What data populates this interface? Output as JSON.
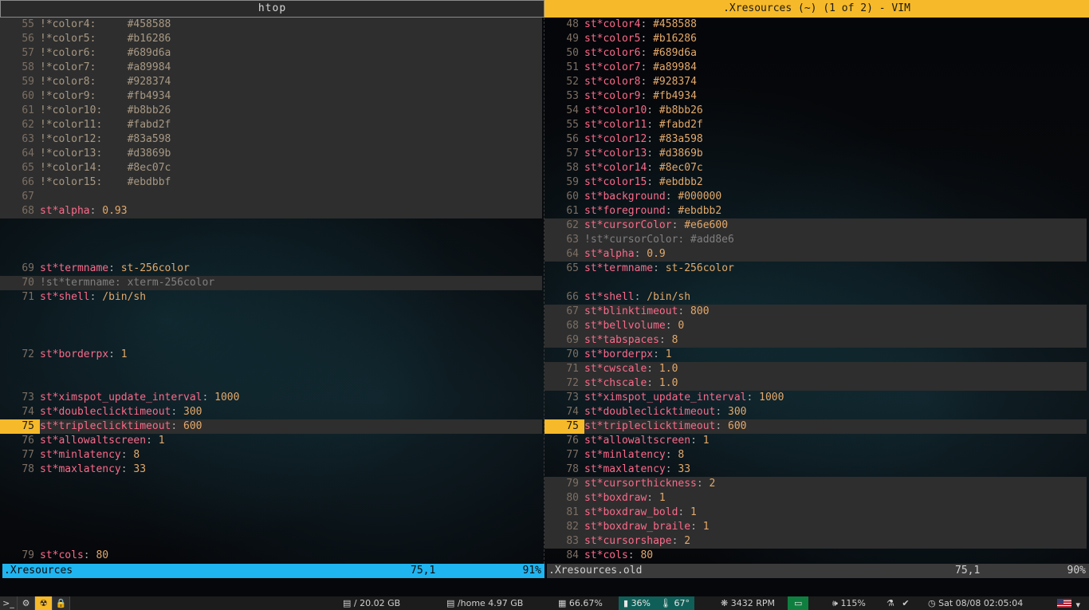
{
  "window": {
    "left_title": "htop",
    "right_title": ".Xresources (~) (1 of 2) - VIM"
  },
  "left_pane": {
    "lines": [
      {
        "n": "55",
        "text": "!*color4:     #458588"
      },
      {
        "n": "56",
        "text": "!*color5:     #b16286"
      },
      {
        "n": "57",
        "text": "!*color6:     #689d6a"
      },
      {
        "n": "58",
        "text": "!*color7:     #a89984"
      },
      {
        "n": "59",
        "text": "!*color8:     #928374"
      },
      {
        "n": "60",
        "text": "!*color9:     #fb4934"
      },
      {
        "n": "61",
        "text": "!*color10:    #b8bb26"
      },
      {
        "n": "62",
        "text": "!*color11:    #fabd2f"
      },
      {
        "n": "63",
        "text": "!*color12:    #83a598"
      },
      {
        "n": "64",
        "text": "!*color13:    #d3869b"
      },
      {
        "n": "65",
        "text": "!*color14:    #8ec07c"
      },
      {
        "n": "66",
        "text": "!*color15:    #ebdbbf"
      },
      {
        "n": "67",
        "text": ""
      },
      {
        "n": "68",
        "key": "st*alpha",
        "val": " 0.93"
      },
      {
        "n": "69",
        "key": "st*termname",
        "val": " st-256color"
      },
      {
        "n": "70",
        "text": "!st*termname: xterm-256color"
      },
      {
        "n": "71",
        "key": "st*shell",
        "val": " /bin/sh"
      },
      {
        "n": "72",
        "key": "st*borderpx",
        "val": " 1"
      },
      {
        "n": "73",
        "key": "st*ximspot_update_interval",
        "val": " 1000"
      },
      {
        "n": "74",
        "key": "st*doubleclicktimeout",
        "val": " 300"
      },
      {
        "n": "75",
        "key": "st*tripleclicktimeout",
        "val": " 600"
      },
      {
        "n": "76",
        "key": "st*allowaltscreen",
        "val": " 1"
      },
      {
        "n": "77",
        "key": "st*minlatency",
        "val": " 8"
      },
      {
        "n": "78",
        "key": "st*maxlatency",
        "val": " 33"
      },
      {
        "n": "79",
        "key": "st*cols",
        "val": " 80"
      }
    ]
  },
  "right_pane": {
    "lines": [
      {
        "n": "48",
        "key": "st*color4",
        "val": " #458588"
      },
      {
        "n": "49",
        "key": "st*color5",
        "val": " #b16286"
      },
      {
        "n": "50",
        "key": "st*color6",
        "val": " #689d6a"
      },
      {
        "n": "51",
        "key": "st*color7",
        "val": " #a89984"
      },
      {
        "n": "52",
        "key": "st*color8",
        "val": " #928374"
      },
      {
        "n": "53",
        "key": "st*color9",
        "val": " #fb4934"
      },
      {
        "n": "54",
        "key": "st*color10",
        "val": " #b8bb26"
      },
      {
        "n": "55",
        "key": "st*color11",
        "val": " #fabd2f"
      },
      {
        "n": "56",
        "key": "st*color12",
        "val": " #83a598"
      },
      {
        "n": "57",
        "key": "st*color13",
        "val": " #d3869b"
      },
      {
        "n": "58",
        "key": "st*color14",
        "val": " #8ec07c"
      },
      {
        "n": "59",
        "key": "st*color15",
        "val": " #ebdbb2"
      },
      {
        "n": "60",
        "key": "st*background",
        "val": " #000000"
      },
      {
        "n": "61",
        "key": "st*foreground",
        "val": " #ebdbb2"
      },
      {
        "n": "62",
        "key": "st*cursorColor",
        "val": " #e6e600"
      },
      {
        "n": "63",
        "text": "!st*cursorColor: #add8e6"
      },
      {
        "n": "64",
        "key": "st*alpha",
        "val": " 0.9"
      },
      {
        "n": "65",
        "key": "st*termname",
        "val": " st-256color"
      },
      {
        "n": "66",
        "key": "st*shell",
        "val": " /bin/sh"
      },
      {
        "n": "67",
        "key": "st*blinktimeout",
        "val": " 800"
      },
      {
        "n": "68",
        "key": "st*bellvolume",
        "val": " 0"
      },
      {
        "n": "69",
        "key": "st*tabspaces",
        "val": " 8"
      },
      {
        "n": "70",
        "key": "st*borderpx",
        "val": " 1"
      },
      {
        "n": "71",
        "key": "st*cwscale",
        "val": " 1.0"
      },
      {
        "n": "72",
        "key": "st*chscale",
        "val": " 1.0"
      },
      {
        "n": "73",
        "key": "st*ximspot_update_interval",
        "val": " 1000"
      },
      {
        "n": "74",
        "key": "st*doubleclicktimeout",
        "val": " 300"
      },
      {
        "n": "75",
        "key": "st*tripleclicktimeout",
        "val": " 600"
      },
      {
        "n": "76",
        "key": "st*allowaltscreen",
        "val": " 1"
      },
      {
        "n": "77",
        "key": "st*minlatency",
        "val": " 8"
      },
      {
        "n": "78",
        "key": "st*maxlatency",
        "val": " 33"
      },
      {
        "n": "79",
        "key": "st*cursorthickness",
        "val": " 2"
      },
      {
        "n": "80",
        "key": "st*boxdraw",
        "val": " 1"
      },
      {
        "n": "81",
        "key": "st*boxdraw_bold",
        "val": " 1"
      },
      {
        "n": "82",
        "key": "st*boxdraw_braile",
        "val": " 1"
      },
      {
        "n": "83",
        "key": "st*cursorshape",
        "val": " 2"
      },
      {
        "n": "84",
        "key": "st*cols",
        "val": " 80"
      }
    ]
  },
  "status": {
    "left_name": ".Xresources",
    "left_pos": "75,1",
    "left_pct": "91%",
    "right_name": ".Xresources.old",
    "right_pos": "75,1",
    "right_pct": "90%"
  },
  "bar": {
    "disk1": "/ 20.02 GB",
    "disk2": "/home 4.97 GB",
    "mem": "66.67%",
    "cpu_temp1": "36%",
    "cpu_temp2": "67°",
    "fan": "3432 RPM",
    "volume": "115%",
    "datetime": "Sat 08/08 02:05:04"
  },
  "colors": {
    "accent_yellow": "#f6b929",
    "status_blue": "#1fb5f0",
    "key_pink": "#fb6a8a",
    "value_orange": "#e3a96b"
  }
}
